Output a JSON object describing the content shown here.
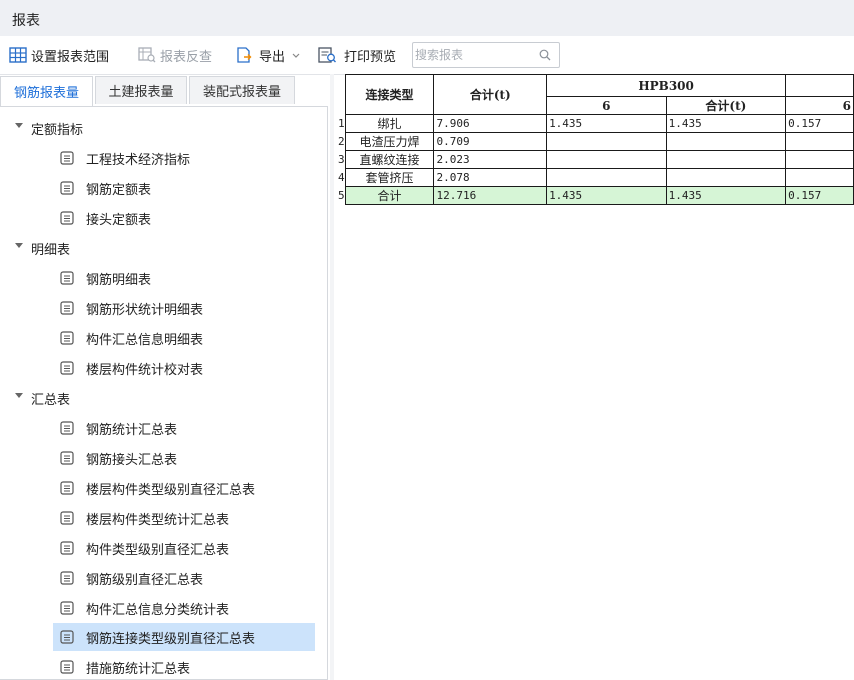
{
  "window": {
    "title": "报表"
  },
  "toolbar": {
    "set_range": "设置报表范围",
    "reverse_check": "报表反查",
    "export": "导出",
    "print_preview": "打印预览",
    "search_placeholder": "搜索报表"
  },
  "tabs": [
    "钢筋报表量",
    "土建报表量",
    "装配式报表量"
  ],
  "tree": {
    "groups": [
      {
        "label": "定额指标",
        "items": [
          "工程技术经济指标",
          "钢筋定额表",
          "接头定额表"
        ]
      },
      {
        "label": "明细表",
        "items": [
          "钢筋明细表",
          "钢筋形状统计明细表",
          "构件汇总信息明细表",
          "楼层构件统计校对表"
        ]
      },
      {
        "label": "汇总表",
        "items": [
          "钢筋统计汇总表",
          "钢筋接头汇总表",
          "楼层构件类型级别直径汇总表",
          "楼层构件类型统计汇总表",
          "构件类型级别直径汇总表",
          "钢筋级别直径汇总表",
          "构件汇总信息分类统计表",
          "钢筋连接类型级别直径汇总表",
          "措施筋统计汇总表"
        ]
      }
    ],
    "selected": "钢筋连接类型级别直径汇总表"
  },
  "report": {
    "headers": {
      "type": "连接类型",
      "total": "合计(t)",
      "group": "HPB300",
      "sub1": "6",
      "sub2": "合计(t)",
      "sub3": "6"
    },
    "rows": [
      {
        "n": "1",
        "type": "绑扎",
        "total": "7.906",
        "c1": "1.435",
        "c2": "1.435",
        "c3": "0.157"
      },
      {
        "n": "2",
        "type": "电渣压力焊",
        "total": "0.709",
        "c1": "",
        "c2": "",
        "c3": ""
      },
      {
        "n": "3",
        "type": "直螺纹连接",
        "total": "2.023",
        "c1": "",
        "c2": "",
        "c3": ""
      },
      {
        "n": "4",
        "type": "套管挤压",
        "total": "2.078",
        "c1": "",
        "c2": "",
        "c3": ""
      },
      {
        "n": "5",
        "type": "合计",
        "total": "12.716",
        "c1": "1.435",
        "c2": "1.435",
        "c3": "0.157"
      }
    ]
  },
  "colors": {
    "accent": "#1e6fd9",
    "selected_bg": "#cce3fb",
    "total_row_bg": "#d6f5d6"
  }
}
